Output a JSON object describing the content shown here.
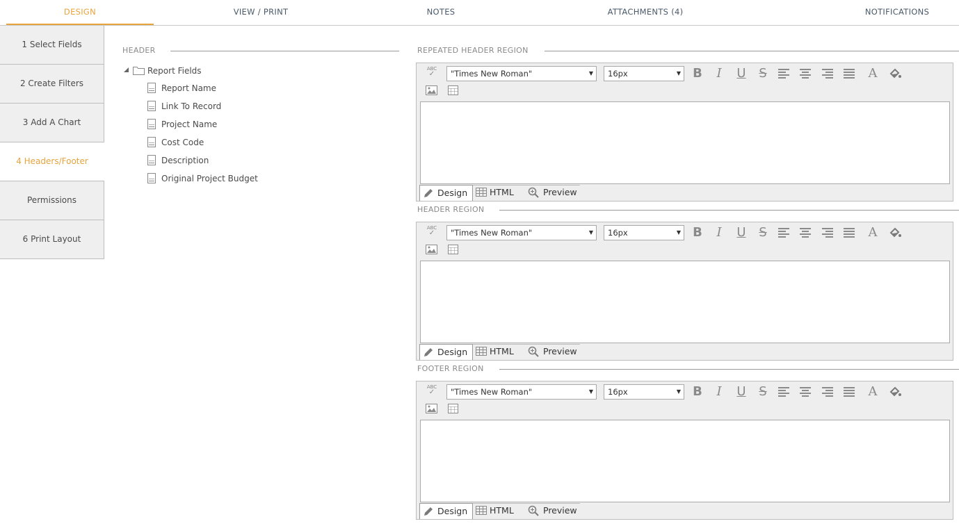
{
  "top_tabs": [
    {
      "label": "DESIGN",
      "active": true
    },
    {
      "label": "VIEW / PRINT"
    },
    {
      "label": "NOTES"
    },
    {
      "label": "ATTACHMENTS (4)"
    },
    {
      "label": "NOTIFICATIONS"
    }
  ],
  "steps": [
    {
      "label": "1 Select Fields"
    },
    {
      "label": "2 Create Filters"
    },
    {
      "label": "3 Add A Chart"
    },
    {
      "label": "4 Headers/Footer",
      "active": true
    },
    {
      "label": "Permissions"
    },
    {
      "label": "6 Print Layout"
    }
  ],
  "fields_panel": {
    "title": "HEADER",
    "root": "Report Fields",
    "items": [
      "Report Name",
      "Link To Record",
      "Project Name",
      "Cost Code",
      "Description",
      "Original Project Budget"
    ]
  },
  "editors": [
    {
      "title": "REPEATED HEADER REGION",
      "font": "\"Times New Roman\"",
      "size": "16px"
    },
    {
      "title": "HEADER REGION",
      "font": "\"Times New Roman\"",
      "size": "16px"
    },
    {
      "title": "FOOTER REGION",
      "font": "\"Times New Roman\"",
      "size": "16px"
    }
  ],
  "editor_modes": [
    "Design",
    "HTML",
    "Preview"
  ],
  "spell_label": "ABC",
  "toolbar_glyphs": {
    "bold": "B",
    "italic": "I",
    "underline": "U",
    "strike": "S",
    "font_color": "A"
  },
  "colors": {
    "accent": "#e8a33d",
    "border": "#bdbdbd",
    "toolbar_bg": "#eeeeee",
    "icon": "#8a8a8a"
  },
  "icons": [
    "spellcheck-icon",
    "bold-icon",
    "italic-icon",
    "underline-icon",
    "strikethrough-icon",
    "align-left-icon",
    "align-center-icon",
    "align-right-icon",
    "align-justify-icon",
    "font-color-icon",
    "fill-color-icon",
    "image-icon",
    "table-icon",
    "pencil-icon",
    "grid-icon",
    "zoom-icon",
    "folder-icon",
    "field-icon"
  ]
}
